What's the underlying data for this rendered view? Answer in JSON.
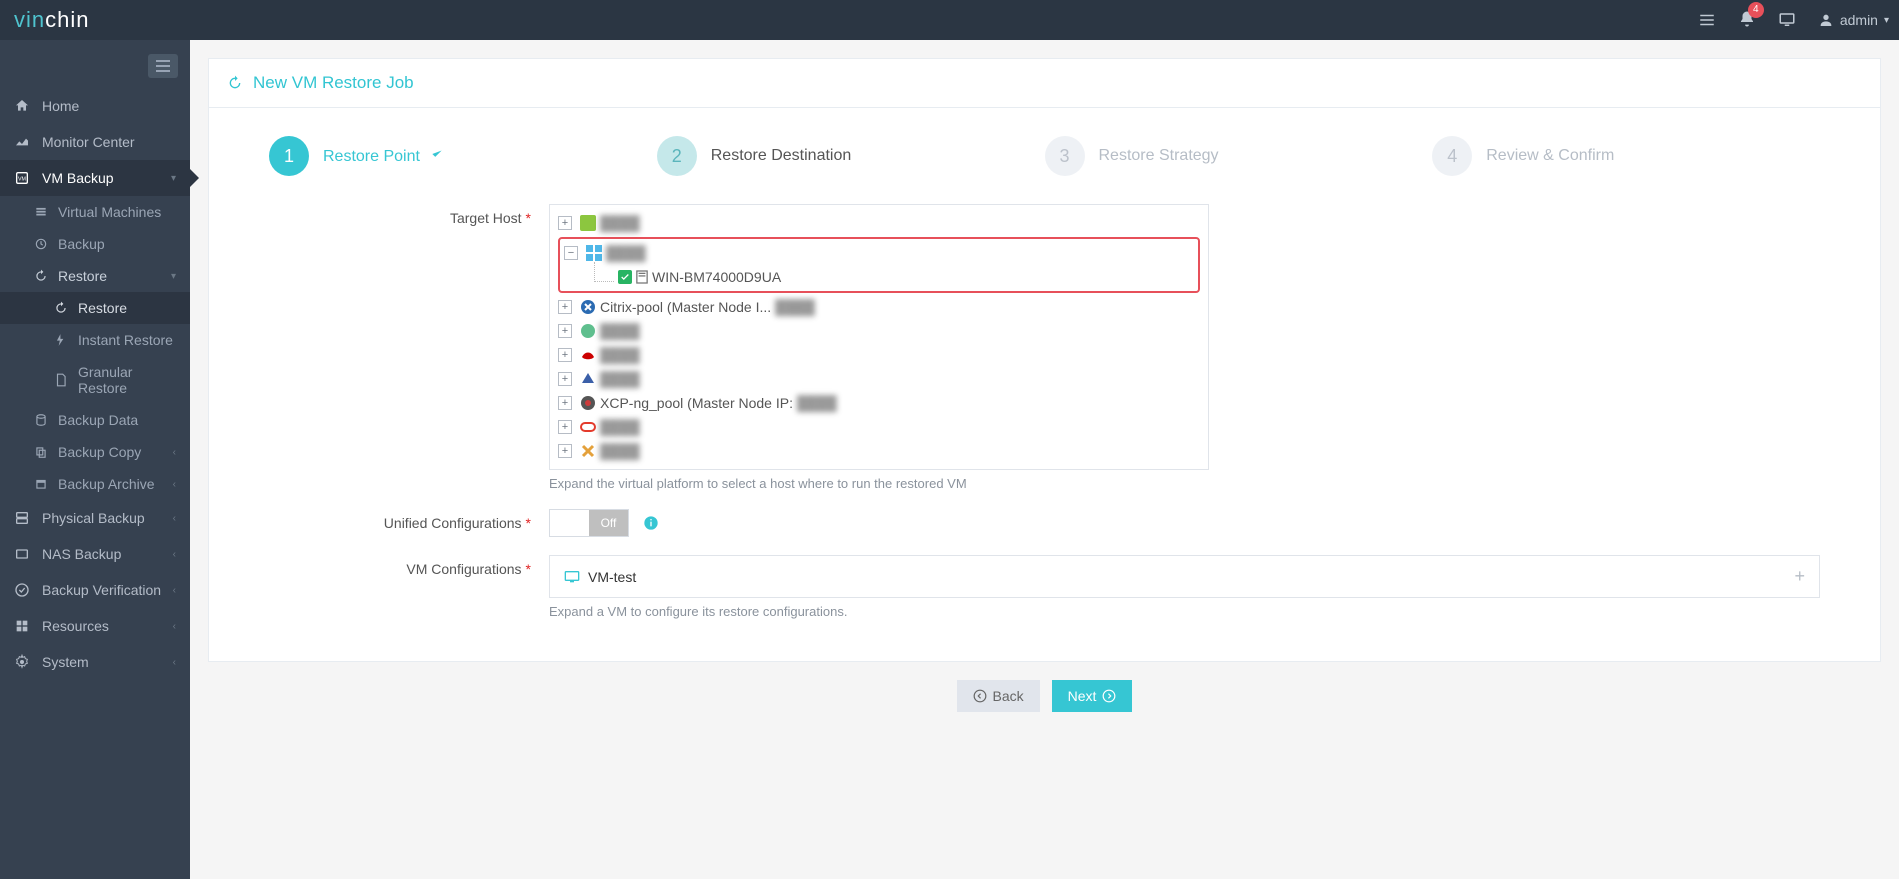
{
  "brand": {
    "part1": "vin",
    "part2": "chin"
  },
  "topbar": {
    "notif_count": "4",
    "username": "admin"
  },
  "sidebar": {
    "home": "Home",
    "monitor": "Monitor Center",
    "vm_backup": "VM Backup",
    "virtual_machines": "Virtual Machines",
    "backup": "Backup",
    "restore": "Restore",
    "sub_restore": "Restore",
    "instant_restore": "Instant Restore",
    "granular_restore": "Granular Restore",
    "backup_data": "Backup Data",
    "backup_copy": "Backup Copy",
    "backup_archive": "Backup Archive",
    "physical_backup": "Physical Backup",
    "nas_backup": "NAS Backup",
    "backup_verification": "Backup Verification",
    "resources": "Resources",
    "system": "System"
  },
  "panel": {
    "title": "New VM Restore Job"
  },
  "steps": [
    {
      "num": "1",
      "label": "Restore Point"
    },
    {
      "num": "2",
      "label": "Restore Destination"
    },
    {
      "num": "3",
      "label": "Restore Strategy"
    },
    {
      "num": "4",
      "label": "Review & Confirm"
    }
  ],
  "form": {
    "target_host_label": "Target Host",
    "unified_conf_label": "Unified Configurations",
    "vm_conf_label": "VM Configurations",
    "target_help": "Expand the virtual platform to select a host where to run the restored VM",
    "vm_conf_help": "Expand a VM to configure its restore configurations.",
    "switch_off": "Off",
    "vm_name": "VM-test"
  },
  "tree": {
    "selected_host": "WIN-BM74000D9UA",
    "citrix": "Citrix-pool (Master Node I...",
    "xcp": "XCP-ng_pool (Master Node IP:",
    "redacted": "████"
  },
  "buttons": {
    "back": "Back",
    "next": "Next"
  }
}
